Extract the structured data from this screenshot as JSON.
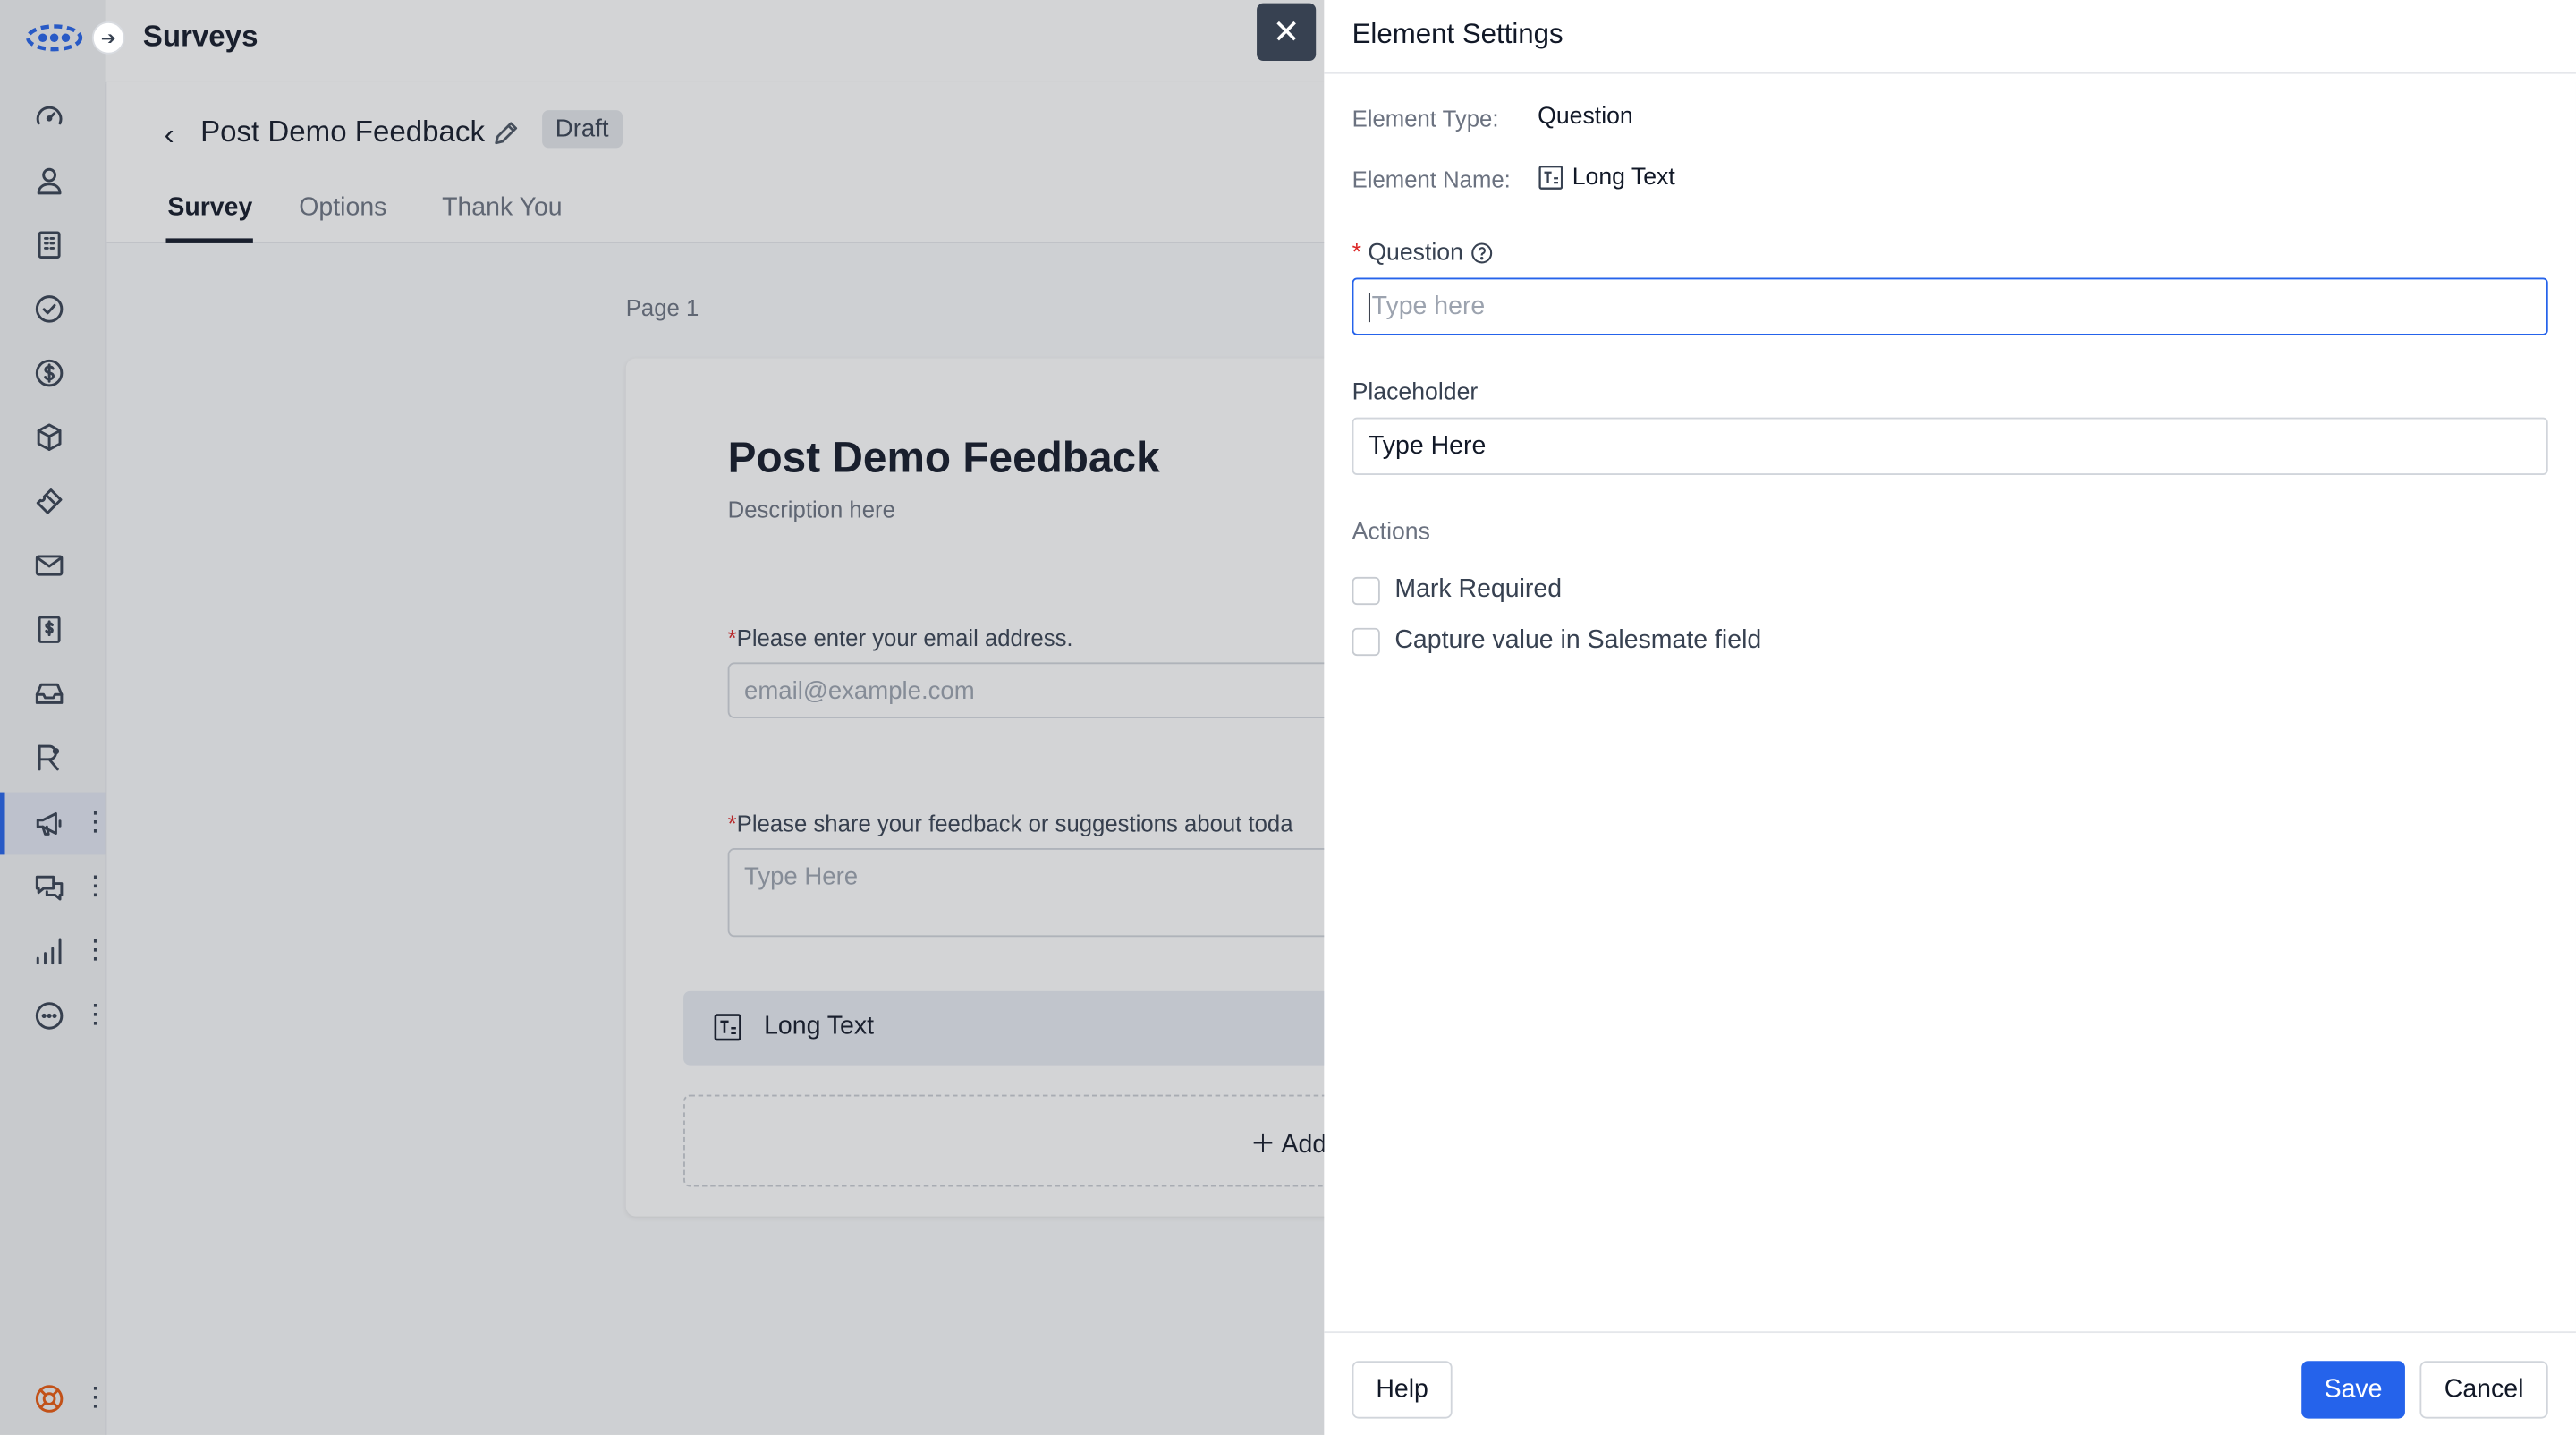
{
  "app": {
    "title": "Surveys",
    "expand_icon": "arrow-right-icon"
  },
  "sidebar": {
    "items": [
      {
        "name": "dashboard",
        "icon": "speedometer-icon"
      },
      {
        "name": "contacts",
        "icon": "user-icon"
      },
      {
        "name": "companies",
        "icon": "building-icon"
      },
      {
        "name": "tasks",
        "icon": "check-circle-icon"
      },
      {
        "name": "deals",
        "icon": "dollar-icon"
      },
      {
        "name": "products",
        "icon": "box-icon"
      },
      {
        "name": "tickets",
        "icon": "ticket-icon"
      },
      {
        "name": "emails",
        "icon": "mail-icon"
      },
      {
        "name": "quotes",
        "icon": "invoice-icon"
      },
      {
        "name": "inbox",
        "icon": "inbox-icon"
      },
      {
        "name": "sequences",
        "icon": "workflow-icon"
      },
      {
        "name": "campaigns",
        "icon": "megaphone-icon",
        "active": true
      },
      {
        "name": "conversations",
        "icon": "chat-icon"
      },
      {
        "name": "reports",
        "icon": "bar-chart-icon"
      },
      {
        "name": "more",
        "icon": "more-circle-icon"
      }
    ],
    "help_icon": "lifebuoy-icon",
    "accent_color": "#2563eb"
  },
  "survey": {
    "name": "Post Demo Feedback",
    "status": "Draft",
    "tabs": [
      {
        "label": "Survey",
        "active": true
      },
      {
        "label": "Options"
      },
      {
        "label": "Thank You"
      }
    ],
    "page_label": "Page 1",
    "form": {
      "title": "Post Demo Feedback",
      "description": "Description here",
      "questions": [
        {
          "label": "Please enter your email address.",
          "required": true,
          "placeholder": "email@example.com"
        },
        {
          "label": "Please share your feedback or suggestions about toda",
          "required": true,
          "placeholder": "Type Here"
        }
      ],
      "selected_element": "Long Text",
      "add_label": "Add"
    }
  },
  "panel": {
    "title": "Element Settings",
    "close_label": "✕",
    "element_type_label": "Element Type:",
    "element_type_value": "Question",
    "element_name_label": "Element Name:",
    "element_name_value": "Long Text",
    "question_label": "Question",
    "question_placeholder": "Type here",
    "question_value": "",
    "placeholder_label": "Placeholder",
    "placeholder_value": "Type Here",
    "actions_label": "Actions",
    "actions": [
      {
        "label": "Mark Required",
        "checked": false
      },
      {
        "label": "Capture value in Salesmate field",
        "checked": false
      }
    ],
    "help_label": "Help",
    "save_label": "Save",
    "cancel_label": "Cancel",
    "primary_color": "#2563eb"
  }
}
